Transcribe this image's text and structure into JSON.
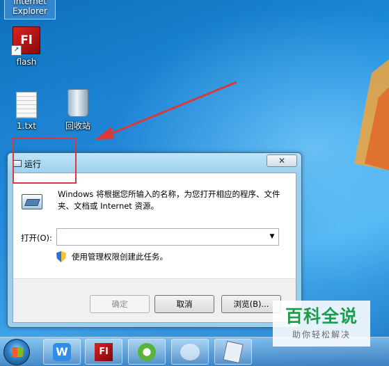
{
  "desktop": {
    "icons": [
      {
        "label_line1": "Internet",
        "label_line2": "Explorer",
        "icon": "internet-explorer-icon"
      },
      {
        "label": "flash",
        "glyph": "Fl",
        "icon": "flash-icon"
      },
      {
        "label": "1.txt",
        "icon": "text-file-icon"
      },
      {
        "label": "回收站",
        "icon": "recycle-bin-icon"
      }
    ]
  },
  "run_dialog": {
    "title": "运行",
    "close_glyph": "✕",
    "description": "Windows 将根据您所输入的名称，为您打开相应的程序、文件夹、文档或 Internet 资源。",
    "open_label": "打开(O):",
    "open_value": "",
    "dropdown_glyph": "▼",
    "admin_note": "使用管理权限创建此任务。",
    "buttons": {
      "ok": "确定",
      "cancel": "取消",
      "browse": "浏览(B)..."
    }
  },
  "taskbar": {
    "items": [
      {
        "icon": "start-orb-icon"
      },
      {
        "icon": "wps-writer-icon",
        "glyph": "W"
      },
      {
        "icon": "flash-icon",
        "glyph": "Fl"
      },
      {
        "icon": "browser-green-icon"
      },
      {
        "icon": "app-ghost-icon"
      },
      {
        "icon": "notepad-icon"
      }
    ]
  },
  "watermark": {
    "main": "百科全说",
    "sub": "助你轻松解决"
  },
  "colors": {
    "annotation_red": "#d9393a",
    "watermark_green": "#1d9c4b"
  }
}
